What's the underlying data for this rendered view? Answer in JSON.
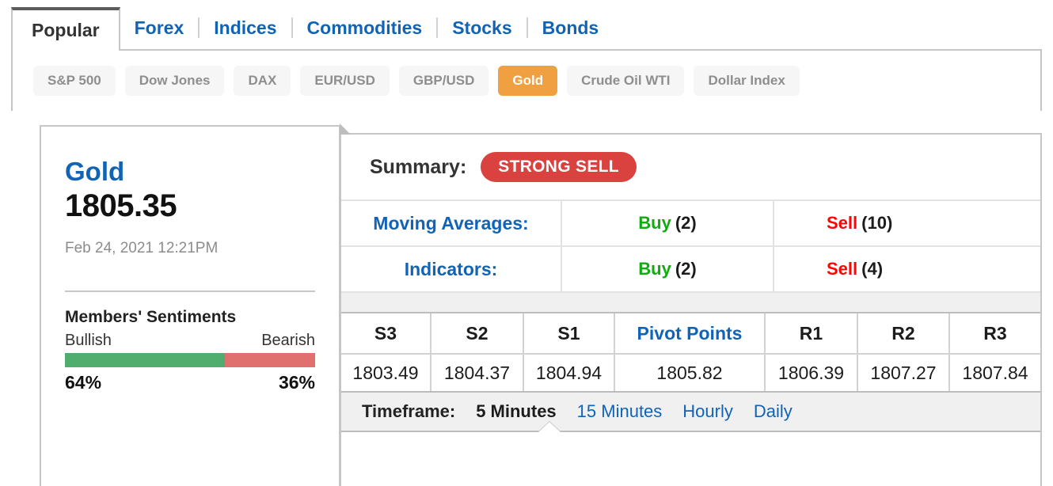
{
  "tabs": [
    {
      "label": "Popular",
      "active": true
    },
    {
      "label": "Forex",
      "active": false
    },
    {
      "label": "Indices",
      "active": false
    },
    {
      "label": "Commodities",
      "active": false
    },
    {
      "label": "Stocks",
      "active": false
    },
    {
      "label": "Bonds",
      "active": false
    }
  ],
  "chips": [
    {
      "label": "S&P 500",
      "selected": false
    },
    {
      "label": "Dow Jones",
      "selected": false
    },
    {
      "label": "DAX",
      "selected": false
    },
    {
      "label": "EUR/USD",
      "selected": false
    },
    {
      "label": "GBP/USD",
      "selected": false
    },
    {
      "label": "Gold",
      "selected": true
    },
    {
      "label": "Crude Oil WTI",
      "selected": false
    },
    {
      "label": "Dollar Index",
      "selected": false
    }
  ],
  "quote": {
    "symbol": "Gold",
    "price": "1805.35",
    "timestamp": "Feb 24, 2021 12:21PM",
    "sentiment_title": "Members' Sentiments",
    "bullish_label": "Bullish",
    "bearish_label": "Bearish",
    "bullish_pct": "64%",
    "bearish_pct": "36%",
    "bullish_value": 64,
    "bearish_value": 36
  },
  "summary": {
    "label": "Summary:",
    "verdict": "STRONG SELL",
    "rows": [
      {
        "name": "Moving Averages:",
        "buy_label": "Buy",
        "buy_count": "(2)",
        "sell_label": "Sell",
        "sell_count": "(10)"
      },
      {
        "name": "Indicators:",
        "buy_label": "Buy",
        "buy_count": "(2)",
        "sell_label": "Sell",
        "sell_count": "(4)"
      }
    ]
  },
  "pivot": {
    "headers": [
      "S3",
      "S2",
      "S1",
      "Pivot Points",
      "R1",
      "R2",
      "R3"
    ],
    "values": [
      "1803.49",
      "1804.37",
      "1804.94",
      "1805.82",
      "1806.39",
      "1807.27",
      "1807.84"
    ]
  },
  "timeframe": {
    "label": "Timeframe:",
    "options": [
      {
        "label": "5 Minutes",
        "active": true
      },
      {
        "label": "15 Minutes",
        "active": false
      },
      {
        "label": "Hourly",
        "active": false
      },
      {
        "label": "Daily",
        "active": false
      }
    ]
  },
  "colors": {
    "link": "#1163b5",
    "buy": "#12ac12",
    "sell": "#fb0606",
    "verdict_badge": "#d9423f",
    "chip_selected": "#f0a040",
    "bullish_bar": "#51ad6e",
    "bearish_bar": "#e0706e"
  }
}
